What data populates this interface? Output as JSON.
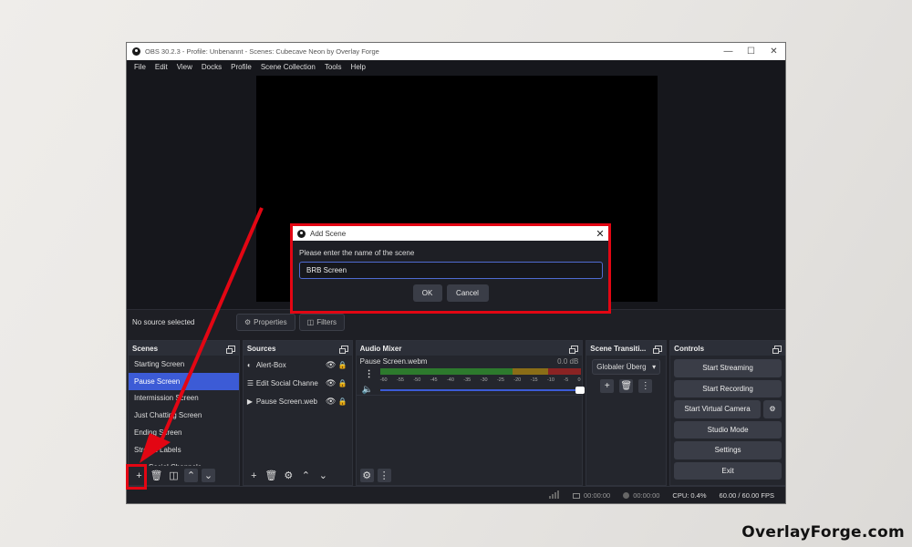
{
  "window": {
    "title": "OBS 30.2.3 - Profile: Unbenannt - Scenes: Cubecave Neon by Overlay Forge",
    "minimize_icon": "minimize-icon",
    "maximize_icon": "maximize-icon",
    "close_icon": "close-icon"
  },
  "menu": [
    "File",
    "Edit",
    "View",
    "Docks",
    "Profile",
    "Scene Collection",
    "Tools",
    "Help"
  ],
  "context_bar": {
    "no_source": "No source selected",
    "properties": "Properties",
    "filters": "Filters"
  },
  "scenes": {
    "title": "Scenes",
    "items": [
      "Starting Screen",
      "Pause Screen",
      "Intermission Screen",
      "Just Chatting Screen",
      "Ending Screen",
      "Stream Labels",
      "Edit Social Channels"
    ],
    "selected_index": 1
  },
  "sources": {
    "title": "Sources",
    "items": [
      {
        "name": "Alert-Box",
        "icon": "globe-icon"
      },
      {
        "name": "Edit Social Channe",
        "icon": "list-icon"
      },
      {
        "name": "Pause Screen.web",
        "icon": "play-icon"
      }
    ]
  },
  "mixer": {
    "title": "Audio Mixer",
    "channel": "Pause Screen.webm",
    "db": "0.0 dB",
    "scale": [
      "-60",
      "-55",
      "-50",
      "-45",
      "-40",
      "-35",
      "-30",
      "-25",
      "-20",
      "-15",
      "-10",
      "-5",
      "0"
    ],
    "volume_fraction": 1.0
  },
  "transitions": {
    "title": "Scene Transiti...",
    "selected": "Globaler Überg"
  },
  "controls": {
    "title": "Controls",
    "start_streaming": "Start Streaming",
    "start_recording": "Start Recording",
    "start_virtual_camera": "Start Virtual Camera",
    "studio_mode": "Studio Mode",
    "settings": "Settings",
    "exit": "Exit"
  },
  "status": {
    "stream_time": "00:00:00",
    "rec_time": "00:00:00",
    "cpu": "CPU: 0.4%",
    "fps": "60.00 / 60.00 FPS"
  },
  "dialog": {
    "title": "Add Scene",
    "prompt": "Please enter the name of the scene",
    "value": "BRB Screen",
    "ok": "OK",
    "cancel": "Cancel"
  },
  "colors": {
    "highlight": "#e30613",
    "selection": "#3c5bd6"
  },
  "watermark": "OverlayForge.com"
}
